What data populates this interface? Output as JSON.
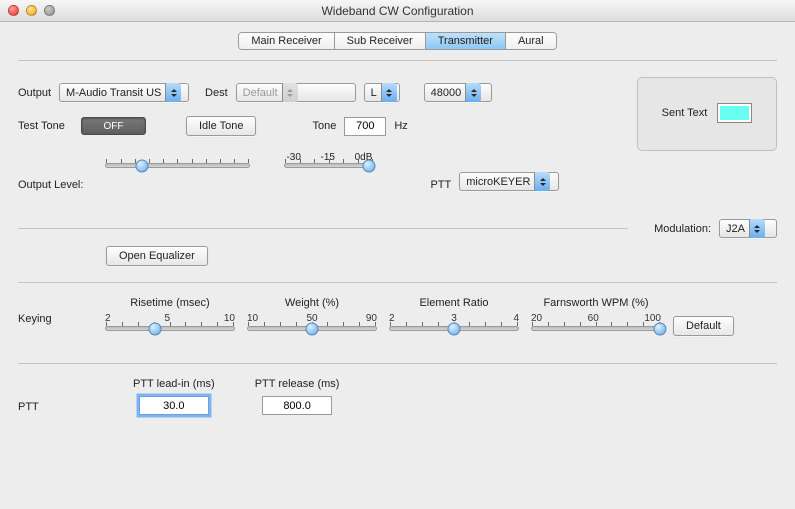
{
  "window": {
    "title": "Wideband CW Configuration"
  },
  "tabs": {
    "items": [
      {
        "label": "Main Receiver"
      },
      {
        "label": "Sub Receiver"
      },
      {
        "label": "Transmitter"
      },
      {
        "label": "Aural"
      }
    ]
  },
  "output": {
    "label": "Output",
    "device": "M-Audio Transit US",
    "dest_label": "Dest",
    "dest_value": "Default",
    "channel": "L",
    "sample_rate": "48000"
  },
  "test_tone": {
    "label": "Test Tone",
    "state": "OFF",
    "idle_button": "Idle Tone",
    "tone_label": "Tone",
    "tone_value": "700",
    "tone_unit": "Hz"
  },
  "output_level": {
    "label": "Output Level:",
    "scale": {
      "a": "-30",
      "b": "-15",
      "c": "0dB"
    }
  },
  "ptt_select": {
    "label": "PTT",
    "value": "microKEYER"
  },
  "sent_text": {
    "label": "Sent Text",
    "color": "#67fff2"
  },
  "modulation": {
    "label": "Modulation:",
    "value": "J2A"
  },
  "equalizer_button": "Open Equalizer",
  "keying": {
    "label": "Keying",
    "risetime": {
      "label": "Risetime (msec)",
      "min": "2",
      "mid": "5",
      "max": "10"
    },
    "weight": {
      "label": "Weight (%)",
      "min": "10",
      "mid": "50",
      "max": "90"
    },
    "ratio": {
      "label": "Element Ratio",
      "min": "2",
      "mid": "3",
      "max": "4"
    },
    "farnsworth": {
      "label": "Farnsworth WPM (%)",
      "min": "20",
      "mid": "60",
      "max": "100"
    },
    "default_button": "Default"
  },
  "ptt": {
    "label": "PTT",
    "leadin": {
      "label": "PTT lead-in (ms)",
      "value": "30.0"
    },
    "release": {
      "label": "PTT release (ms)",
      "value": "800.0"
    }
  }
}
